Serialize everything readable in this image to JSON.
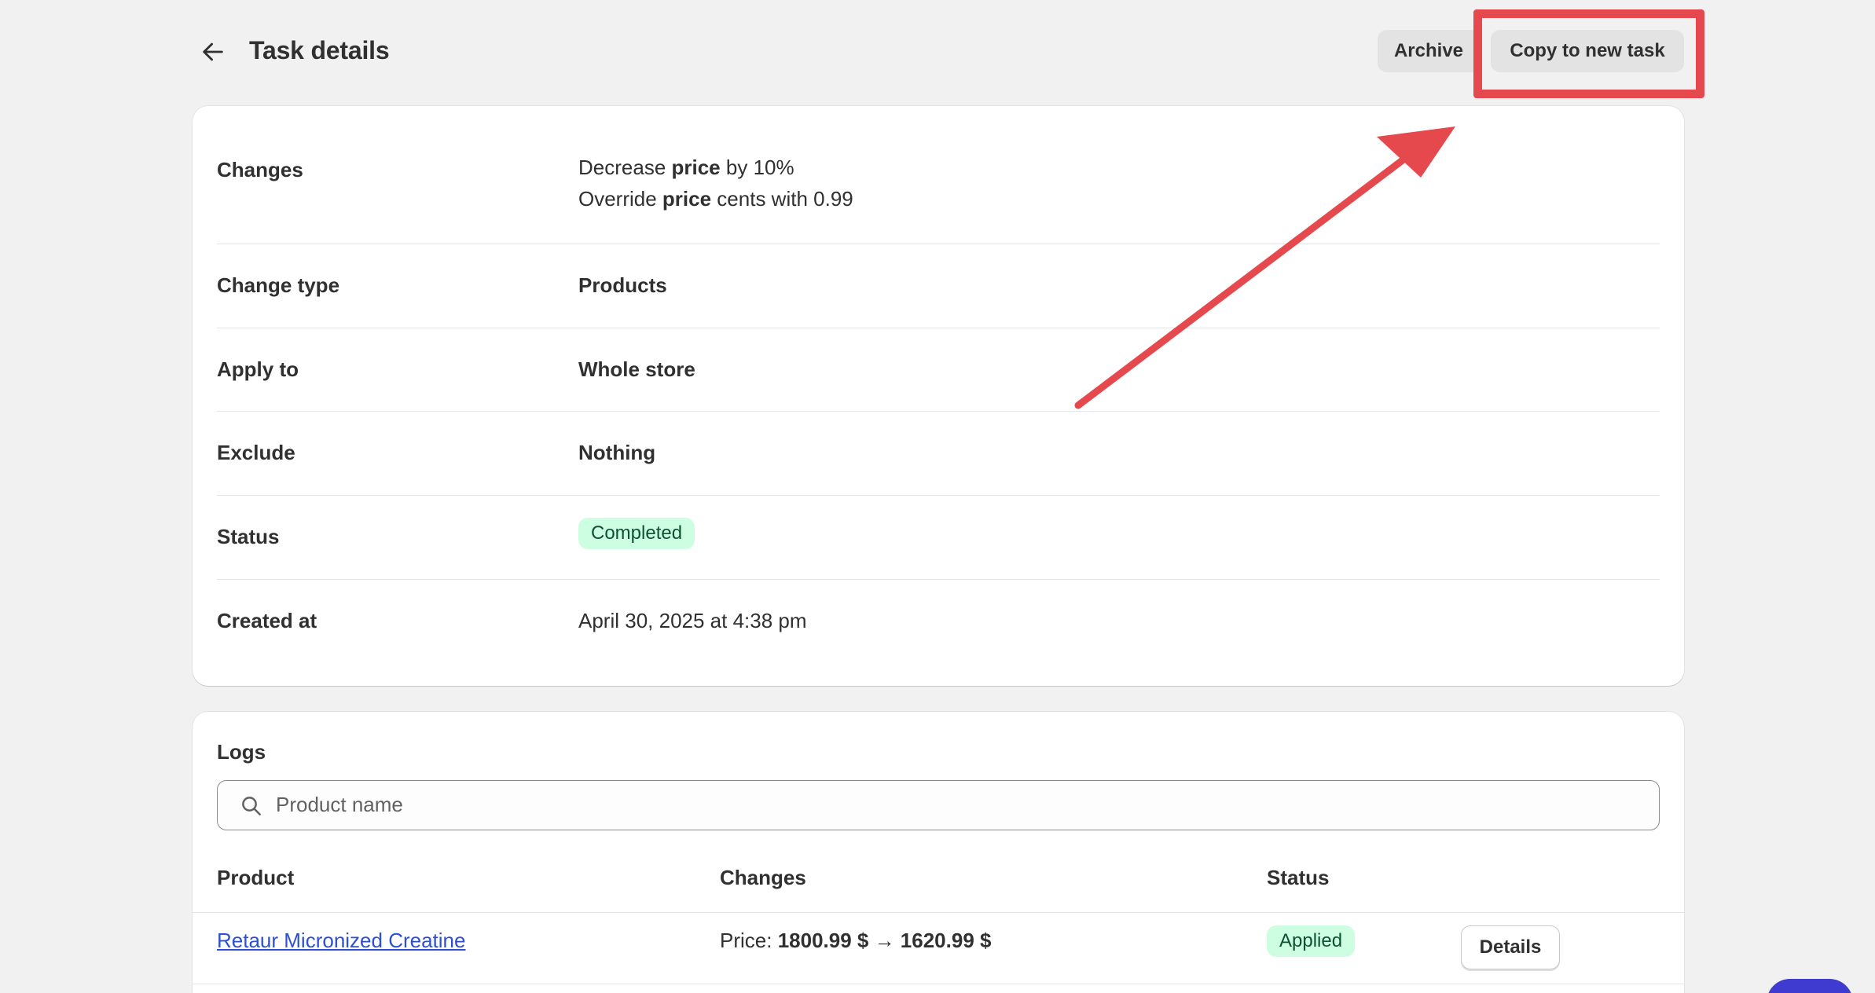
{
  "header": {
    "title": "Task details",
    "archive_label": "Archive",
    "copy_label": "Copy to new task"
  },
  "details": {
    "changes": {
      "label": "Changes",
      "line1": {
        "prefix": "Decrease ",
        "bold": "price",
        "suffix": " by 10%"
      },
      "line2": {
        "prefix": "Override ",
        "bold": "price",
        "suffix": " cents with 0.99"
      }
    },
    "change_type": {
      "label": "Change type",
      "value": "Products"
    },
    "apply_to": {
      "label": "Apply to",
      "value": "Whole store"
    },
    "exclude": {
      "label": "Exclude",
      "value": "Nothing"
    },
    "status": {
      "label": "Status",
      "value": "Completed"
    },
    "created_at": {
      "label": "Created at",
      "value": "April 30, 2025 at 4:38 pm"
    }
  },
  "logs": {
    "title": "Logs",
    "search_placeholder": "Product name",
    "columns": {
      "product": "Product",
      "changes": "Changes",
      "status": "Status"
    },
    "rows": [
      {
        "product": "Retaur Micronized Creatine",
        "changes_prefix": "Price: ",
        "changes_value": "1800.99 $ → 1620.99 $",
        "status": "Applied",
        "action": "Details"
      }
    ]
  },
  "colors": {
    "annotation": "#e5484d",
    "badge_bg": "#cdfee1",
    "badge_text": "#0c5132",
    "link": "#2c4fd4"
  }
}
